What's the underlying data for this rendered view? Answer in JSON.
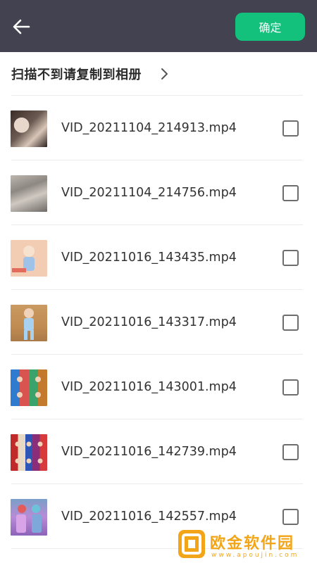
{
  "header": {
    "confirm_label": "确定",
    "back_icon": "arrow-left-icon",
    "bar_color": "#424250",
    "accent_color": "#13c07c"
  },
  "hint": {
    "text": "扫描不到请复制到相册",
    "chevron_icon": "chevron-right-icon"
  },
  "files": [
    {
      "name": "VID_20211104_214913.mp4",
      "checked": false
    },
    {
      "name": "VID_20211104_214756.mp4",
      "checked": false
    },
    {
      "name": "VID_20211016_143435.mp4",
      "checked": false
    },
    {
      "name": "VID_20211016_143317.mp4",
      "checked": false
    },
    {
      "name": "VID_20211016_143001.mp4",
      "checked": false
    },
    {
      "name": "VID_20211016_142739.mp4",
      "checked": false
    },
    {
      "name": "VID_20211016_142557.mp4",
      "checked": false
    }
  ],
  "watermark": {
    "name": "欧金软件园",
    "url": "www.apoujin.com"
  }
}
